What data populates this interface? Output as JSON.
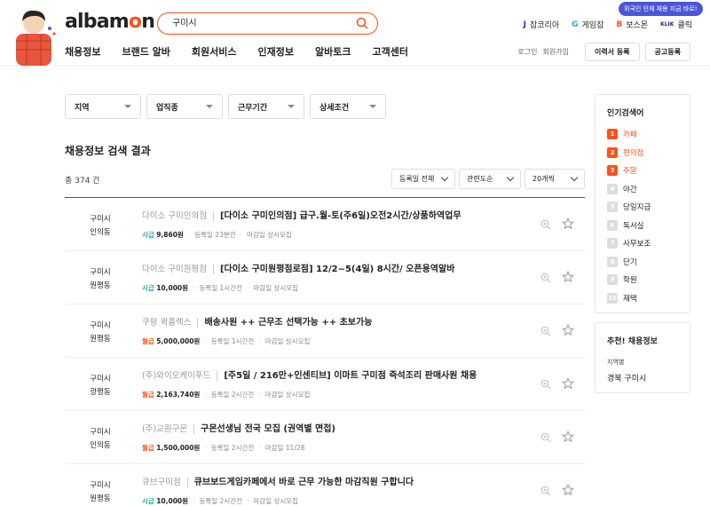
{
  "header": {
    "logo_prefix": "alba",
    "logo_o": "o",
    "logo_suffix": "n",
    "logo_m": "m",
    "search_value": "구미시",
    "nav": [
      "채용정보",
      "브랜드 알바",
      "회원서비스",
      "인재정보",
      "알바토크",
      "고객센터"
    ],
    "partners": [
      {
        "mark": "J",
        "label": "잡코리아",
        "color": "#2b2bd6"
      },
      {
        "mark": "G",
        "label": "게임잡",
        "color": "#3a9bd9"
      },
      {
        "mark": "B",
        "label": "보스몬",
        "color": "#ff501b"
      },
      {
        "mark": "KLIK",
        "label": "클릭",
        "color": "#1f2a6b"
      }
    ],
    "promo": "외국인 인재 채용 지금 바로!",
    "login": "로그인",
    "signup": "회원가입",
    "resume_button": "이력서 등록",
    "post_button": "공고등록"
  },
  "filters": [
    "지역",
    "업직종",
    "근무기간",
    "상세조건"
  ],
  "results": {
    "title": "채용정보 검색 결과",
    "total": "총 374 건",
    "sort_date": "등록일 전체",
    "sort_relevance": "관련도순",
    "sort_count": "20개씩"
  },
  "jobs": [
    {
      "city": "구미시",
      "area": "인의동",
      "company": "다이소 구미인의점",
      "title": "[다이소 구미인의점] 급구.월-토(주6일)오전2시간/상품하역업무",
      "pay_type": "시급",
      "pay_color": "#2ea3a3",
      "pay": "9,860원",
      "posted": "등록일 23분전",
      "deadline": "마감일 상시모집"
    },
    {
      "city": "구미시",
      "area": "원평동",
      "company": "다이소 구미원평점",
      "title": "[다이소 구미원평점로점] 12/2~5(4일) 8시간/ 오픈용역알바",
      "pay_type": "시급",
      "pay_color": "#2ea3a3",
      "pay": "10,000원",
      "posted": "등록일 1시간전",
      "deadline": "마감일 상시모집"
    },
    {
      "city": "구미시",
      "area": "원평동",
      "company": "쿠팡 퀵플렉스",
      "title": "배송사원 ++ 근무조 선택가능 ++ 초보가능",
      "pay_type": "월급",
      "pay_color": "#ff501b",
      "pay": "5,000,000원",
      "posted": "등록일 1시간전",
      "deadline": "마감일 상시모집"
    },
    {
      "city": "구미시",
      "area": "광평동",
      "company": "(주)와이오케이푸드",
      "title": "[주5일 / 216만+인센티브] 이마트 구미점 즉석조리 판매사원 채용",
      "pay_type": "월급",
      "pay_color": "#ff501b",
      "pay": "2,163,740원",
      "posted": "등록일 2시간전",
      "deadline": "마감일 상시모집"
    },
    {
      "city": "구미시",
      "area": "인의동",
      "company": "(주)교원구몬",
      "title": "구몬선생님 전국 모집 (권역별 면접)",
      "pay_type": "월급",
      "pay_color": "#ff501b",
      "pay": "1,500,000원",
      "posted": "등록일 2시간전",
      "deadline": "마감일 11/28"
    },
    {
      "city": "구미시",
      "area": "원평동",
      "company": "큐브구미점",
      "title": "큐브보드게임카페에서 바로 근무 가능한 마감직원 구합니다",
      "pay_type": "시급",
      "pay_color": "#2ea3a3",
      "pay": "10,000원",
      "posted": "등록일 2시간전",
      "deadline": "마감일 상시모집"
    }
  ],
  "popular": {
    "title": "인기검색어",
    "items": [
      {
        "rank": "1",
        "label": "카페",
        "hot": true
      },
      {
        "rank": "2",
        "label": "편의점",
        "hot": true
      },
      {
        "rank": "3",
        "label": "주말",
        "hot": true
      },
      {
        "rank": "4",
        "label": "야간",
        "hot": false
      },
      {
        "rank": "5",
        "label": "당일지급",
        "hot": false
      },
      {
        "rank": "6",
        "label": "독서실",
        "hot": false
      },
      {
        "rank": "7",
        "label": "사무보조",
        "hot": false
      },
      {
        "rank": "8",
        "label": "단기",
        "hot": false
      },
      {
        "rank": "9",
        "label": "학원",
        "hot": false
      },
      {
        "rank": "10",
        "label": "재택",
        "hot": false
      }
    ]
  },
  "recommend": {
    "title": "추천! 채용정보",
    "label": "지역별",
    "value": "경북 구미시"
  },
  "colors": {
    "accent": "#ff501b",
    "hourly": "#2ea3a3",
    "monthly": "#ff501b"
  }
}
